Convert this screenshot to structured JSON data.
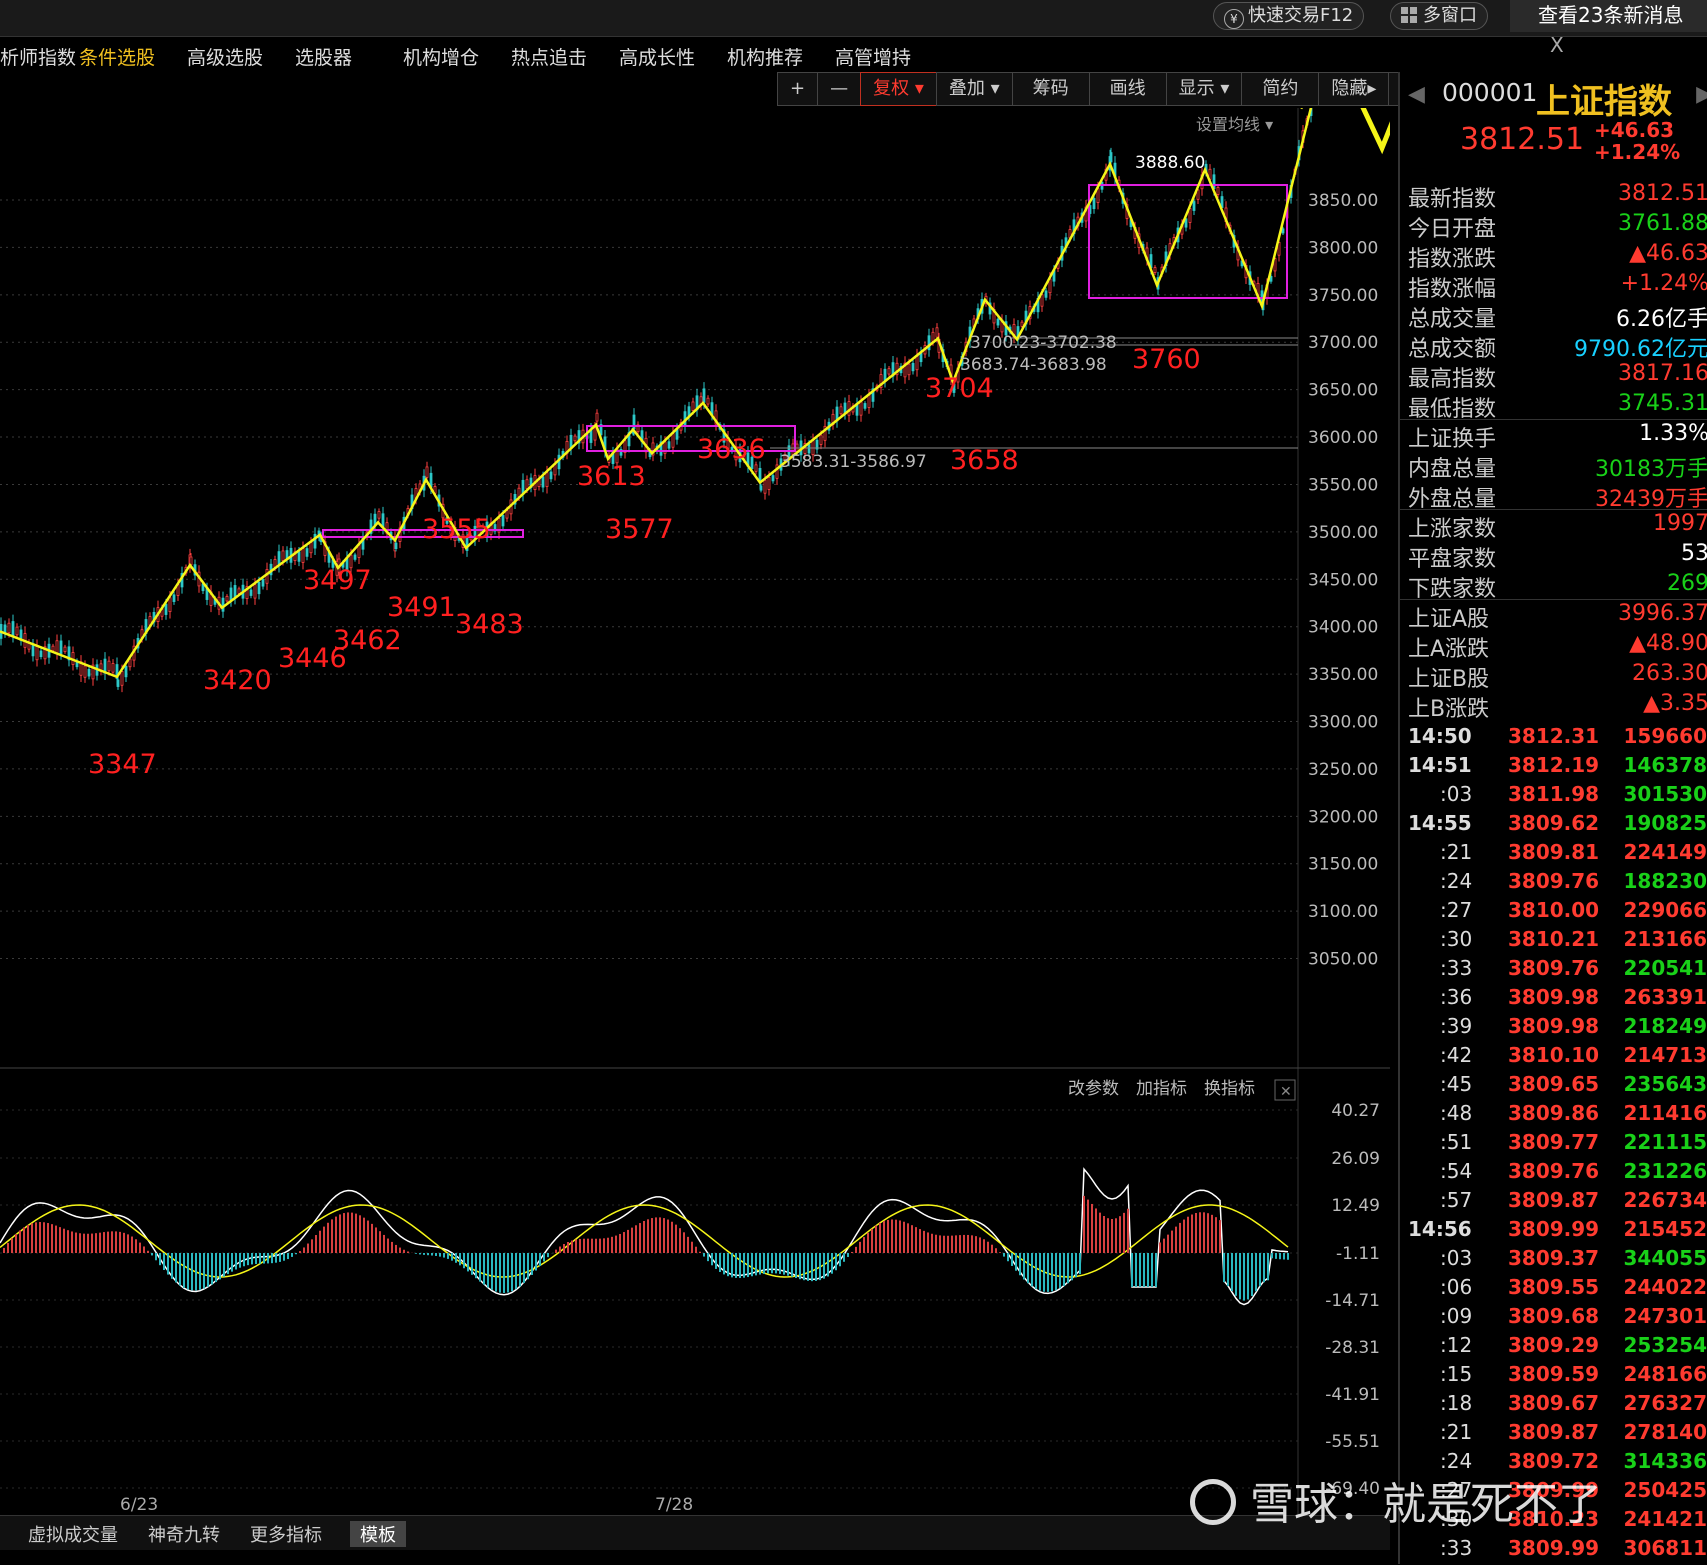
{
  "topbar": {
    "quick_trade": "快速交易F12",
    "multi_window": "多窗口",
    "messages": "查看23条新消息",
    "close": "X"
  },
  "menu": [
    "析师指数",
    "条件选股",
    "高级选股",
    "选股器",
    "机构增仓",
    "热点追击",
    "高成长性",
    "机构推荐",
    "高管增持"
  ],
  "toolbar": [
    "+",
    "—",
    "复权",
    "叠加",
    "筹码",
    "画线",
    "显示",
    "简约",
    "隐藏"
  ],
  "chart": {
    "ma_setting": "设置均线",
    "y_labels": [
      "3850.00",
      "3800.00",
      "3750.00",
      "3700.00",
      "3650.00",
      "3600.00",
      "3550.00",
      "3500.00",
      "3450.00",
      "3400.00",
      "3350.00",
      "3300.00",
      "3250.00",
      "3200.00",
      "3150.00",
      "3100.00",
      "3050.00"
    ],
    "annotations": [
      "3347",
      "3420",
      "3446",
      "3462",
      "3497",
      "3491",
      "3555",
      "3483",
      "3613",
      "3577",
      "3636",
      "3704",
      "3658",
      "3760"
    ],
    "high_label": "3888.60",
    "range_labels": [
      "3700.23-3702.38",
      "3683.74-3683.98",
      "3583.31-3586.97"
    ],
    "x_labels": [
      "6/23",
      "7/28"
    ],
    "indicator_buttons": [
      "改参数",
      "加指标",
      "换指标"
    ],
    "indicator_y_labels": [
      "40.27",
      "26.09",
      "12.49",
      "-1.11",
      "-14.71",
      "-28.31",
      "-41.91",
      "-55.51",
      "-69.40"
    ]
  },
  "quote": {
    "code": "000001",
    "name": "上证指数",
    "price": "3812.51",
    "change": "+46.63",
    "pct": "+1.24%",
    "rows": [
      {
        "label": "最新指数",
        "value": "3812.51",
        "color": "#ff3b30"
      },
      {
        "label": "今日开盘",
        "value": "3761.88",
        "color": "#19d119"
      },
      {
        "label": "指数涨跌",
        "value": "▲46.63",
        "color": "#ff3b30"
      },
      {
        "label": "指数涨幅",
        "value": "+1.24%",
        "color": "#ff3b30"
      },
      {
        "label": "总成交量",
        "value": "6.26亿手",
        "color": "#ffffff"
      },
      {
        "label": "总成交额",
        "value": "9790.62亿元",
        "color": "#19d1ff"
      },
      {
        "label": "最高指数",
        "value": "3817.16",
        "color": "#ff3b30"
      },
      {
        "label": "最低指数",
        "value": "3745.31",
        "color": "#19d119"
      },
      {
        "label": "上证换手",
        "value": "1.33%",
        "color": "#ffffff"
      },
      {
        "label": "内盘总量",
        "value": "30183万手",
        "color": "#19d119"
      },
      {
        "label": "外盘总量",
        "value": "32439万手",
        "color": "#ff3b30"
      },
      {
        "label": "上涨家数",
        "value": "1997",
        "color": "#ff3b30"
      },
      {
        "label": "平盘家数",
        "value": "53",
        "color": "#ffffff"
      },
      {
        "label": "下跌家数",
        "value": "269",
        "color": "#19d119"
      },
      {
        "label": "上证A股",
        "value": "3996.37",
        "color": "#ff3b30"
      },
      {
        "label": "上A涨跌",
        "value": "▲48.90",
        "color": "#ff3b30"
      },
      {
        "label": "上证B股",
        "value": "263.30",
        "color": "#ff3b30"
      },
      {
        "label": "上B涨跌",
        "value": "▲3.35",
        "color": "#ff3b30"
      }
    ],
    "ticks": [
      {
        "t": "14:50",
        "p": "3812.31",
        "v": "159660",
        "vc": "#ff3b30"
      },
      {
        "t": "14:51",
        "p": "3812.19",
        "v": "146378",
        "vc": "#19d119"
      },
      {
        "t": ":03",
        "p": "3811.98",
        "v": "301530",
        "vc": "#19d119"
      },
      {
        "t": "14:55",
        "p": "3809.62",
        "v": "190825",
        "vc": "#19d119"
      },
      {
        "t": ":21",
        "p": "3809.81",
        "v": "224149",
        "vc": "#ff3b30"
      },
      {
        "t": ":24",
        "p": "3809.76",
        "v": "188230",
        "vc": "#19d119"
      },
      {
        "t": ":27",
        "p": "3810.00",
        "v": "229066",
        "vc": "#ff3b30"
      },
      {
        "t": ":30",
        "p": "3810.21",
        "v": "213166",
        "vc": "#ff3b30"
      },
      {
        "t": ":33",
        "p": "3809.76",
        "v": "220541",
        "vc": "#19d119"
      },
      {
        "t": ":36",
        "p": "3809.98",
        "v": "263391",
        "vc": "#ff3b30"
      },
      {
        "t": ":39",
        "p": "3809.98",
        "v": "218249",
        "vc": "#19d119"
      },
      {
        "t": ":42",
        "p": "3810.10",
        "v": "214713",
        "vc": "#ff3b30"
      },
      {
        "t": ":45",
        "p": "3809.65",
        "v": "235643",
        "vc": "#19d119"
      },
      {
        "t": ":48",
        "p": "3809.86",
        "v": "211416",
        "vc": "#ff3b30"
      },
      {
        "t": ":51",
        "p": "3809.77",
        "v": "221115",
        "vc": "#19d119"
      },
      {
        "t": ":54",
        "p": "3809.76",
        "v": "231226",
        "vc": "#19d119"
      },
      {
        "t": ":57",
        "p": "3809.87",
        "v": "226734",
        "vc": "#ff3b30"
      },
      {
        "t": "14:56",
        "p": "3809.99",
        "v": "215452",
        "vc": "#ff3b30"
      },
      {
        "t": ":03",
        "p": "3809.37",
        "v": "344055",
        "vc": "#19d119"
      },
      {
        "t": ":06",
        "p": "3809.55",
        "v": "244022",
        "vc": "#ff3b30"
      },
      {
        "t": ":09",
        "p": "3809.68",
        "v": "247301",
        "vc": "#ff3b30"
      },
      {
        "t": ":12",
        "p": "3809.29",
        "v": "253254",
        "vc": "#19d119"
      },
      {
        "t": ":15",
        "p": "3809.59",
        "v": "248166",
        "vc": "#ff3b30"
      },
      {
        "t": ":18",
        "p": "3809.67",
        "v": "276327",
        "vc": "#ff3b30"
      },
      {
        "t": ":21",
        "p": "3809.87",
        "v": "278140",
        "vc": "#ff3b30"
      },
      {
        "t": ":24",
        "p": "3809.72",
        "v": "314336",
        "vc": "#19d119"
      },
      {
        "t": ":27",
        "p": "3809.99",
        "v": "250425",
        "vc": "#ff3b30"
      },
      {
        "t": ":30",
        "p": "3810.23",
        "v": "241421",
        "vc": "#ff3b30"
      },
      {
        "t": ":33",
        "p": "3809.99",
        "v": "306811",
        "vc": "#ff3b30"
      }
    ]
  },
  "bottom": [
    "虚拟成交量",
    "神奇九转",
    "更多指标",
    "模板"
  ],
  "watermark": "雪球：就是死不了"
}
